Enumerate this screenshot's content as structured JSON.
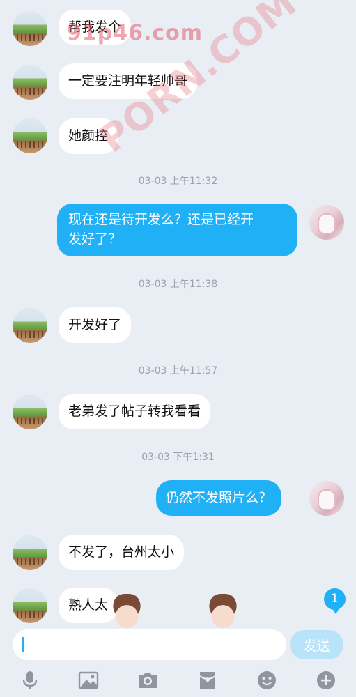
{
  "messages": [
    {
      "side": "left",
      "text": "帮我发个"
    },
    {
      "side": "left",
      "text": "一定要注明年轻帅哥"
    },
    {
      "side": "left",
      "text": "她颜控"
    },
    {
      "time": "03-03 上午11:32"
    },
    {
      "side": "right",
      "text_line1": "现在还是待开发么？还是已经开",
      "text_line2": "发好了？"
    },
    {
      "time": "03-03 上午11:38"
    },
    {
      "side": "left",
      "text": "开发好了"
    },
    {
      "time": "03-03 上午11:57"
    },
    {
      "side": "left",
      "text": "老弟发了帖子转我看看"
    },
    {
      "time": "03-03 下午1:31"
    },
    {
      "side": "right",
      "text": "仍然不发照片么？"
    },
    {
      "side": "left",
      "text": "不发了，台州太小"
    },
    {
      "side": "left",
      "text": "熟人太"
    }
  ],
  "watermark": {
    "top": "91p46.com",
    "diagonal": "PORN.COM"
  },
  "unread_badge": "1",
  "input": {
    "value": "",
    "placeholder": ""
  },
  "send_label": "发送",
  "toolbar_icons": [
    "microphone-icon",
    "image-icon",
    "camera-icon",
    "red-packet-icon",
    "emoji-icon",
    "plus-icon"
  ],
  "colors": {
    "background": "#e9edf4",
    "bubble_self": "#20b0f5",
    "bubble_other": "#ffffff",
    "send_disabled": "#b9e3f8",
    "icon": "#8f96a0"
  }
}
